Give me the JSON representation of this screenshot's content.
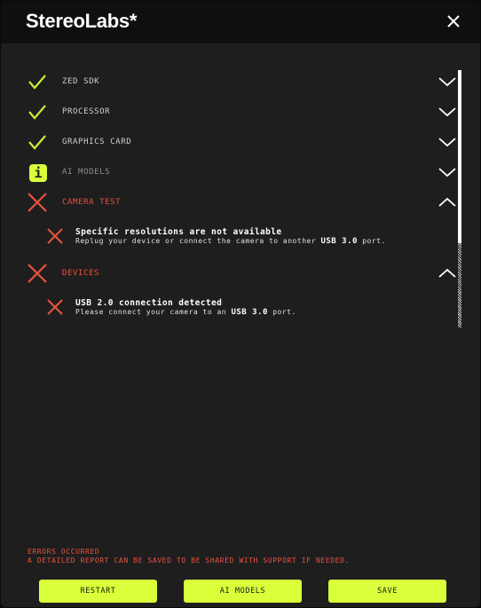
{
  "window": {
    "title": "StereoLabs*"
  },
  "checks": [
    {
      "label": "ZED SDK",
      "status": "ok",
      "expanded": false
    },
    {
      "label": "PROCESSOR",
      "status": "ok",
      "expanded": false
    },
    {
      "label": "GRAPHICS CARD",
      "status": "ok",
      "expanded": false
    },
    {
      "label": "AI MODELS",
      "status": "info",
      "expanded": false
    },
    {
      "label": "CAMERA TEST",
      "status": "error",
      "expanded": true,
      "issue": {
        "title": "Specific resolutions are not available",
        "desc_before": "Replug your device or connect the camera to another ",
        "desc_bold": "USB 3.0",
        "desc_after": " port."
      }
    },
    {
      "label": "DEVICES",
      "status": "error",
      "expanded": true,
      "issue": {
        "title": "USB 2.0 connection detected",
        "desc_before": "Please connect your camera to an ",
        "desc_bold": "USB 3.0",
        "desc_after": " port."
      }
    }
  ],
  "info_icon_text": "i",
  "footer": {
    "errors_line1": "ERRORS OCCURRED",
    "errors_line2": "A DETAILED REPORT CAN BE SAVED TO BE SHARED WITH SUPPORT IF NEEDED."
  },
  "buttons": {
    "restart": "RESTART",
    "ai_models": "AI MODELS",
    "save": "SAVE"
  },
  "colors": {
    "accent": "#d8ff3a",
    "ok": "#c8f03a",
    "error": "#e8533f",
    "background": "#1e1e1e",
    "titlebar": "#0f0f0f"
  }
}
